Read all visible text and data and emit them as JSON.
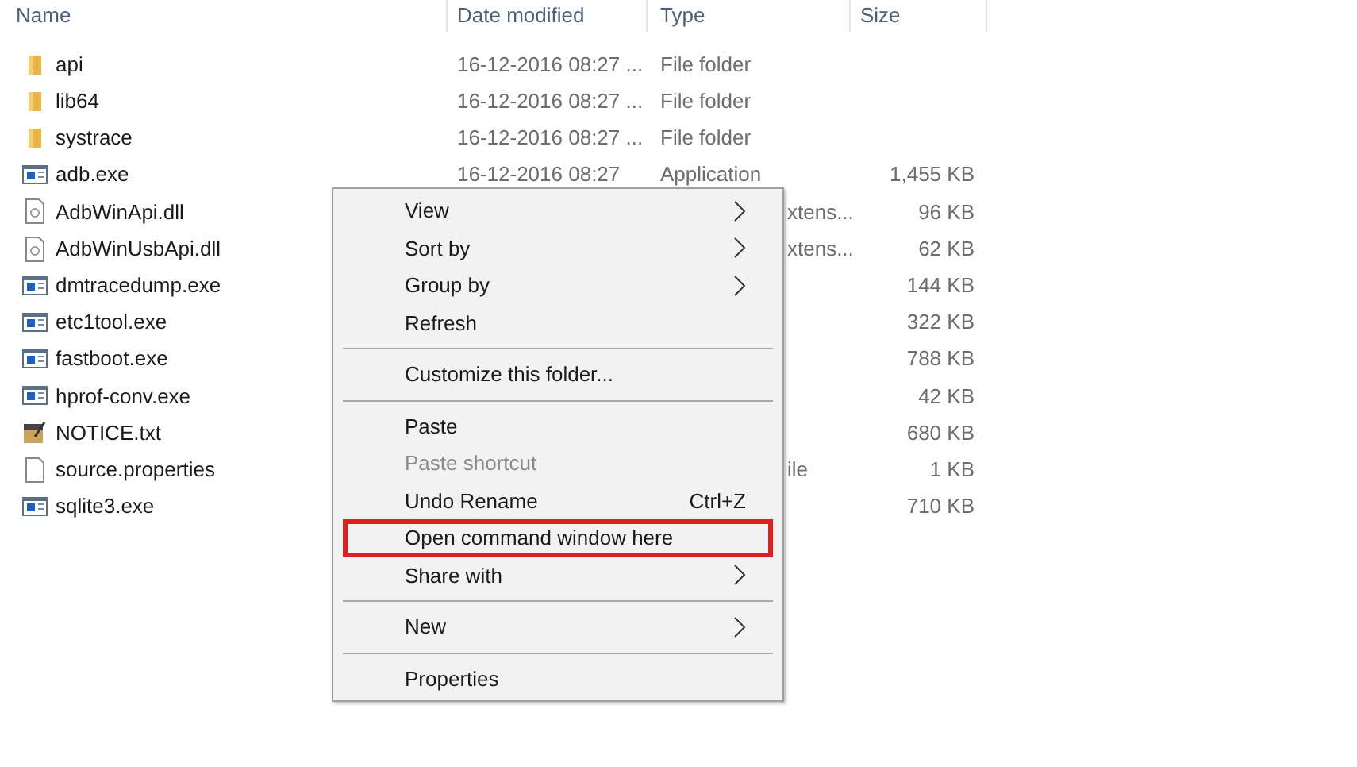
{
  "columns": [
    "Name",
    "Date modified",
    "Type",
    "Size"
  ],
  "rows": [
    {
      "kind": "folder",
      "name": "api",
      "date": "16-12-2016 08:27 ...",
      "type": "File folder"
    },
    {
      "kind": "folder",
      "name": "lib64",
      "date": "16-12-2016 08:27 ...",
      "type": "File folder"
    },
    {
      "kind": "folder",
      "name": "systrace",
      "date": "16-12-2016 08:27 ...",
      "type": "File folder"
    },
    {
      "kind": "exe",
      "name": "adb.exe",
      "date": "16-12-2016 08:27",
      "type": "Application",
      "size": "1,455 KB"
    },
    {
      "kind": "dll",
      "name": "AdbWinApi.dll",
      "type": "xtens...",
      "size": "96 KB"
    },
    {
      "kind": "dll",
      "name": "AdbWinUsbApi.dll",
      "type": "xtens...",
      "size": "62 KB"
    },
    {
      "kind": "exe",
      "name": "dmtracedump.exe",
      "size": "144 KB"
    },
    {
      "kind": "exe",
      "name": "etc1tool.exe",
      "size": "322 KB"
    },
    {
      "kind": "exe",
      "name": "fastboot.exe",
      "size": "788 KB"
    },
    {
      "kind": "exe",
      "name": "hprof-conv.exe",
      "size": "42 KB"
    },
    {
      "kind": "txt",
      "name": "NOTICE.txt",
      "size": "680 KB"
    },
    {
      "kind": "file",
      "name": "source.properties",
      "type": "ile",
      "size": "1 KB"
    },
    {
      "kind": "exe",
      "name": "sqlite3.exe",
      "size": "710 KB"
    }
  ],
  "context_menu": [
    {
      "kind": "item",
      "label": "View",
      "submenu": true,
      "disabled": false,
      "outlined": false
    },
    {
      "kind": "item",
      "label": "Sort by",
      "submenu": true,
      "disabled": false,
      "outlined": false
    },
    {
      "kind": "item",
      "label": "Group by",
      "submenu": true,
      "disabled": false,
      "outlined": false
    },
    {
      "kind": "item",
      "label": "Refresh",
      "submenu": false,
      "disabled": false,
      "outlined": false
    },
    {
      "kind": "separator"
    },
    {
      "kind": "item",
      "label": "Customize this folder...",
      "submenu": false,
      "disabled": false,
      "outlined": false
    },
    {
      "kind": "separator"
    },
    {
      "kind": "item",
      "label": "Paste",
      "submenu": false,
      "disabled": false,
      "outlined": false
    },
    {
      "kind": "item",
      "label": "Paste shortcut",
      "submenu": false,
      "disabled": true,
      "outlined": false
    },
    {
      "kind": "item",
      "label": "Undo Rename",
      "shortcut": "Ctrl+Z",
      "submenu": false,
      "disabled": false,
      "outlined": false
    },
    {
      "kind": "item",
      "label": "Open command window here",
      "submenu": false,
      "disabled": false,
      "outlined": true
    },
    {
      "kind": "item",
      "label": "Share with",
      "submenu": true,
      "disabled": false,
      "outlined": false
    },
    {
      "kind": "separator"
    },
    {
      "kind": "item",
      "label": "New",
      "submenu": true,
      "disabled": false,
      "outlined": false
    },
    {
      "kind": "separator"
    },
    {
      "kind": "item",
      "label": "Properties",
      "submenu": false,
      "disabled": false,
      "outlined": false
    }
  ]
}
